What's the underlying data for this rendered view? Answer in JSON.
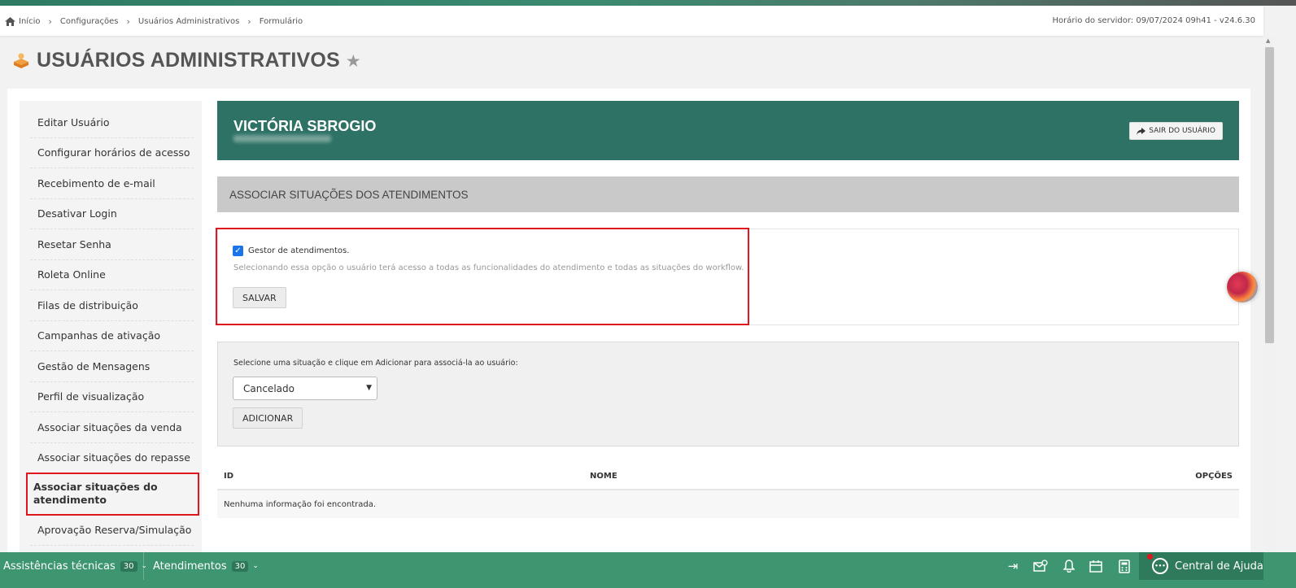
{
  "breadcrumb": {
    "items": [
      "Início",
      "Configurações",
      "Usuários Administrativos",
      "Formulário"
    ],
    "server_time": "Horário do servidor: 09/07/2024 09h41 - v24.6.30"
  },
  "page": {
    "title": "USUÁRIOS ADMINISTRATIVOS"
  },
  "sidebar": {
    "items": [
      {
        "label": "Editar Usuário"
      },
      {
        "label": "Configurar horários de acesso"
      },
      {
        "label": "Recebimento de e-mail"
      },
      {
        "label": "Desativar Login"
      },
      {
        "label": "Resetar Senha"
      },
      {
        "label": "Roleta Online"
      },
      {
        "label": "Filas de distribuição"
      },
      {
        "label": "Campanhas de ativação"
      },
      {
        "label": "Gestão de Mensagens"
      },
      {
        "label": "Perfil de visualização"
      },
      {
        "label": "Associar situações da venda"
      },
      {
        "label": "Associar situações do repasse"
      },
      {
        "label": "Associar situações do atendimento",
        "active": true
      },
      {
        "label": "Aprovação Reserva/Simulação"
      }
    ]
  },
  "user": {
    "name": "VICTÓRIA SBROGIO",
    "logout_label": "SAIR DO USUÁRIO"
  },
  "section": {
    "title": "ASSOCIAR SITUAÇÕES DOS ATENDIMENTOS"
  },
  "gestor": {
    "checkbox_label": "Gestor de atendimentos.",
    "checked": true,
    "help": "Selecionando essa opção o usuário terá acesso a todas as funcionalidades do atendimento e todas as situações do workflow.",
    "save_label": "SALVAR"
  },
  "associate": {
    "label": "Selecione uma situação e clique em Adicionar para associá-la ao usuário:",
    "selected": "Cancelado",
    "add_label": "ADICIONAR"
  },
  "table": {
    "columns": [
      "ID",
      "NOME",
      "OPÇÕES"
    ],
    "empty": "Nenhuma informação foi encontrada."
  },
  "bottombar": {
    "items": [
      {
        "label": "Assistências técnicas",
        "count": "30"
      },
      {
        "label": "Atendimentos",
        "count": "30"
      }
    ],
    "icons": [
      "collapse-right-icon",
      "mail-settings-icon",
      "bell-icon",
      "calendar-icon",
      "calculator-icon"
    ],
    "help_center": "Central de Ajuda"
  },
  "colors": {
    "accent": "#2e7265",
    "bottombar": "#3e9670",
    "highlight": "#e0161e"
  }
}
